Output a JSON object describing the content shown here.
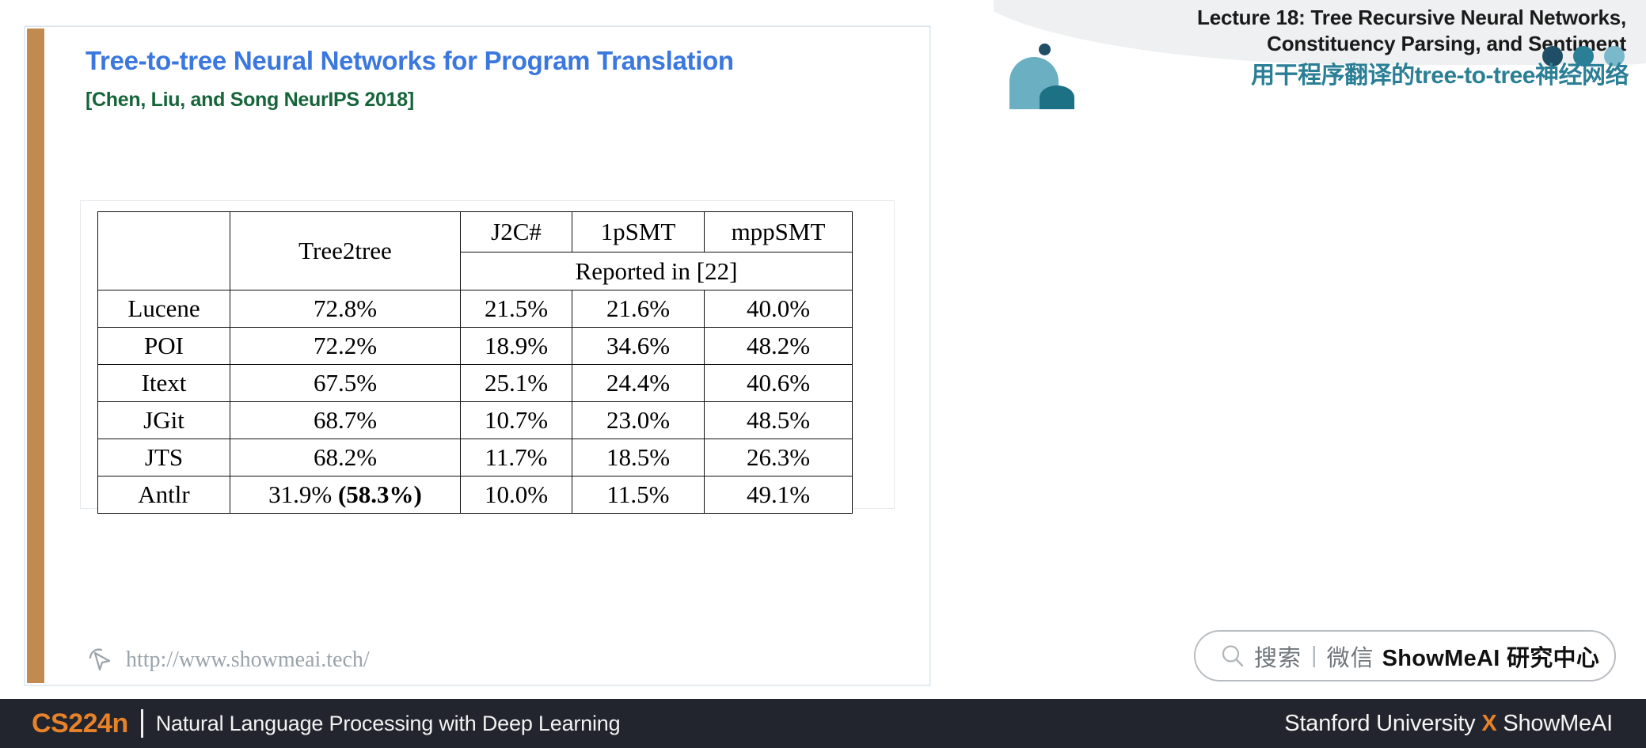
{
  "header": {
    "lecture_title_line1": "Lecture 18: Tree Recursive Neural Networks,",
    "lecture_title_line2": "Constituency Parsing, and Sentiment",
    "zh_subtitle": "用干程序翻译的tree-to-tree神经网络",
    "dot_colors": [
      "#1f4e66",
      "#2a7f96",
      "#7ab8cc"
    ],
    "logo_light": "#6aafc2",
    "logo_dark": "#1c7184",
    "logo_dot": "#1f4e66"
  },
  "slide": {
    "title": "Tree-to-tree Neural Networks for Program Translation",
    "subtitle": "[Chen, Liu, and Song NeurIPS 2018]",
    "title_color": "#3a77de",
    "subtitle_color": "#16653a",
    "accent_bar_color": "#c08a51",
    "watermark_url": "http://www.showmeai.tech/"
  },
  "table": {
    "corner_label": "",
    "col_tree2tree": "Tree2tree",
    "col_j2c": "J2C#",
    "col_1psmt": "1pSMT",
    "col_mppsmt": "mppSMT",
    "reported_label": "Reported in [22]",
    "rows": [
      {
        "name": "Lucene",
        "tree2tree": "72.8%",
        "tree2tree_paren": "",
        "j2c": "21.5%",
        "smt1p": "21.6%",
        "mpp": "40.0%"
      },
      {
        "name": "POI",
        "tree2tree": "72.2%",
        "tree2tree_paren": "",
        "j2c": "18.9%",
        "smt1p": "34.6%",
        "mpp": "48.2%"
      },
      {
        "name": "Itext",
        "tree2tree": "67.5%",
        "tree2tree_paren": "",
        "j2c": "25.1%",
        "smt1p": "24.4%",
        "mpp": "40.6%"
      },
      {
        "name": "JGit",
        "tree2tree": "68.7%",
        "tree2tree_paren": "",
        "j2c": "10.7%",
        "smt1p": "23.0%",
        "mpp": "48.5%"
      },
      {
        "name": "JTS",
        "tree2tree": "68.2%",
        "tree2tree_paren": "",
        "j2c": "11.7%",
        "smt1p": "18.5%",
        "mpp": "26.3%"
      },
      {
        "name": "Antlr",
        "tree2tree": "31.9% ",
        "tree2tree_paren": "(58.3%)",
        "j2c": "10.0%",
        "smt1p": "11.5%",
        "mpp": "49.1%"
      }
    ]
  },
  "search": {
    "label": "搜索",
    "separator": "|",
    "channel": "微信",
    "brand": "ShowMeAI 研究中心"
  },
  "footer": {
    "course_code": "CS224n",
    "course_name": "Natural Language Processing with Deep Learning",
    "right_prefix": "Stanford University ",
    "right_x": "X",
    "right_suffix": " ShowMeAI",
    "accent_color": "#e8822a",
    "bar_color": "#22252d"
  }
}
